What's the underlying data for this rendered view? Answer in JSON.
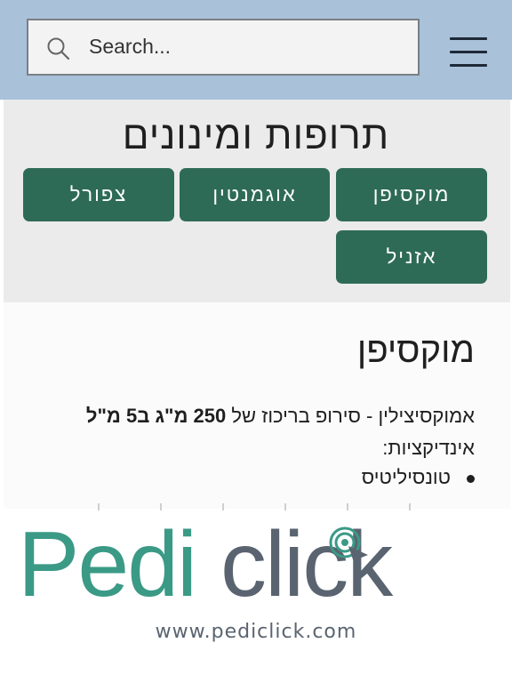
{
  "search": {
    "placeholder": "Search..."
  },
  "header": {
    "menu_icon": "hamburger-menu-icon",
    "search_icon": "search-icon"
  },
  "section": {
    "title": "תרופות ומינונים"
  },
  "medications": [
    {
      "label": "מוקסיפן"
    },
    {
      "label": "אוגמנטין"
    },
    {
      "label": "צפורל"
    },
    {
      "label": "אזניל"
    }
  ],
  "content": {
    "title": "מוקסיפן",
    "desc_prefix": "אמוקסיצילין - סירופ בריכוז של",
    "desc_bold": "250 מ\"ג ב5 מ\"ל",
    "indications_label": "אינדיקציות:",
    "indications": [
      "טונסיליטיס"
    ]
  },
  "brand": {
    "logo_text_1": "Pedi",
    "logo_text_2": "click",
    "url": "www.pediclick.com"
  },
  "colors": {
    "header_bg": "#a9c1d9",
    "button_bg": "#2e6b57",
    "logo_teal": "#3a9a86",
    "logo_gray": "#5a6470"
  }
}
